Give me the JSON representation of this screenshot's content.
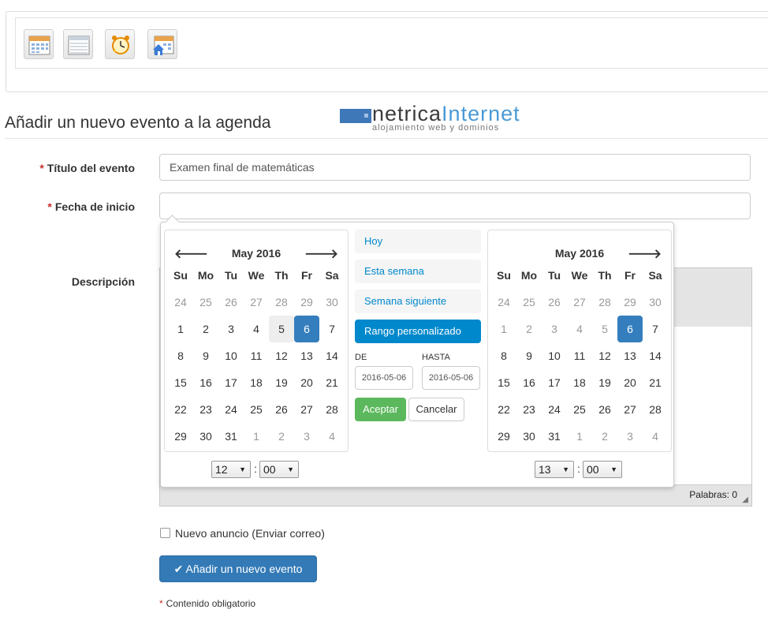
{
  "toolbar": {
    "icons": [
      "calendar-month-icon",
      "calendar-list-icon",
      "alarm-clock-icon",
      "calendar-home-icon"
    ]
  },
  "header": {
    "title": "Añadir un nuevo evento a la agenda",
    "logo_main": "netrica",
    "logo_accent": "Internet",
    "logo_tagline": "alojamiento web y dominios"
  },
  "form": {
    "required_mark": "*",
    "title_label": "Título del evento",
    "title_value": "Examen final de matemáticas",
    "start_label": "Fecha de inicio",
    "start_value": "",
    "description_label": "Descripción",
    "word_count": "Palabras: 0",
    "announce_label": "Nuevo anuncio (Enviar correo)",
    "submit_label": "Añadir un nuevo evento",
    "required_note": "Contenido obligatorio"
  },
  "picker": {
    "left_month": "May 2016",
    "right_month": "May 2016",
    "weekdays": [
      "Su",
      "Mo",
      "Tu",
      "We",
      "Th",
      "Fr",
      "Sa"
    ],
    "weeks": [
      [
        "24",
        "25",
        "26",
        "27",
        "28",
        "29",
        "30"
      ],
      [
        "1",
        "2",
        "3",
        "4",
        "5",
        "6",
        "7"
      ],
      [
        "8",
        "9",
        "10",
        "11",
        "12",
        "13",
        "14"
      ],
      [
        "15",
        "16",
        "17",
        "18",
        "19",
        "20",
        "21"
      ],
      [
        "22",
        "23",
        "24",
        "25",
        "26",
        "27",
        "28"
      ],
      [
        "29",
        "30",
        "31",
        "1",
        "2",
        "3",
        "4"
      ]
    ],
    "ranges": [
      "Hoy",
      "Esta semana",
      "Semana siguiente",
      "Rango personalizado"
    ],
    "from_label": "DE",
    "to_label": "HASTA",
    "from_value": "2016-05-06",
    "to_value": "2016-05-06",
    "apply_label": "Aceptar",
    "cancel_label": "Cancelar",
    "left_hour": "12",
    "left_minute": "00",
    "right_hour": "13",
    "right_minute": "00",
    "time_sep": ":"
  },
  "colors": {
    "accent": "#337ab7",
    "range_selected": "#0088cc",
    "apply": "#5cb85c",
    "required": "#c9302c"
  }
}
